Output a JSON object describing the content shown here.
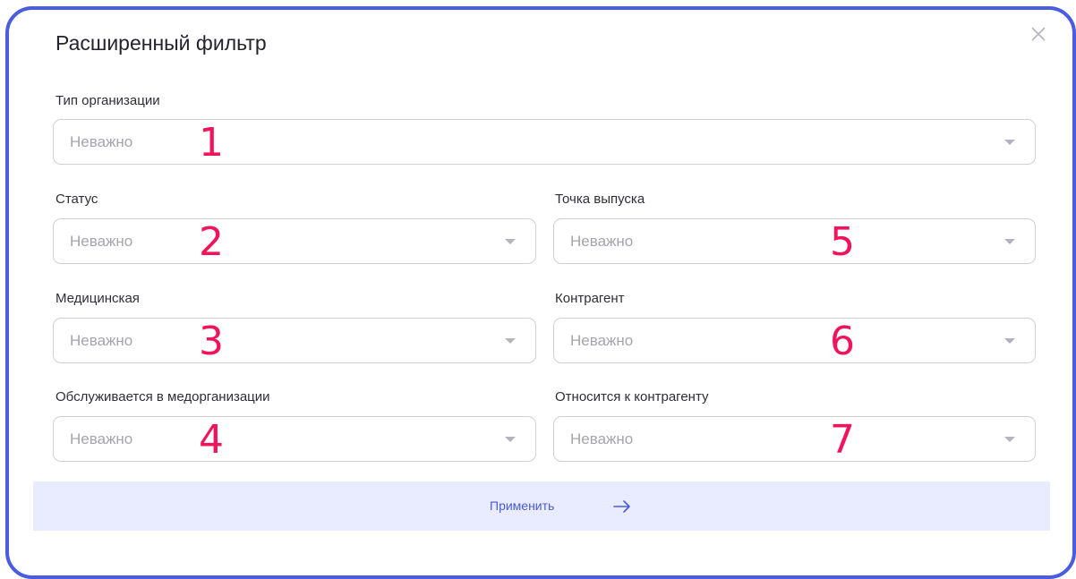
{
  "dialog": {
    "title": "Расширенный фильтр",
    "close_icon": "close-icon",
    "accent_color": "#4a5ce0",
    "marker_color": "#f0145a"
  },
  "fields": {
    "org_type": {
      "label": "Тип организации",
      "placeholder": "Неважно",
      "marker": "1"
    },
    "status": {
      "label": "Статус",
      "placeholder": "Неважно",
      "marker": "2"
    },
    "medical": {
      "label": "Медицинская",
      "placeholder": "Неважно",
      "marker": "3"
    },
    "served_in_medorg": {
      "label": "Обслуживается в медорганизации",
      "placeholder": "Неважно",
      "marker": "4"
    },
    "issue_point": {
      "label": "Точка выпуска",
      "placeholder": "Неважно",
      "marker": "5"
    },
    "counterparty": {
      "label": "Контрагент",
      "placeholder": "Неважно",
      "marker": "6"
    },
    "belongs_to_counterparty": {
      "label": "Относится к контрагенту",
      "placeholder": "Неважно",
      "marker": "7"
    }
  },
  "footer": {
    "apply_label": "Применить",
    "apply_icon": "arrow-right-icon"
  }
}
